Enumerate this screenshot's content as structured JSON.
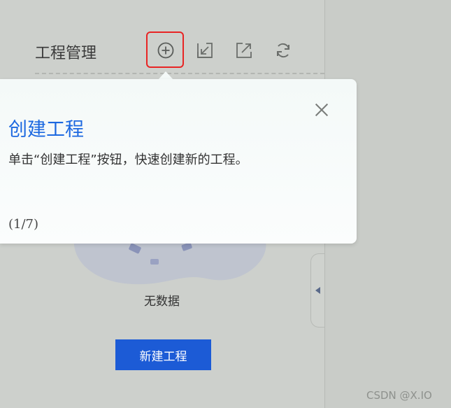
{
  "panel": {
    "title": "工程管理",
    "toolbar": [
      {
        "icon": "add-circle-icon",
        "label": "创建工程"
      },
      {
        "icon": "import-icon"
      },
      {
        "icon": "export-icon"
      },
      {
        "icon": "refresh-icon"
      }
    ],
    "empty_text": "无数据",
    "create_button_label": "新建工程"
  },
  "popover": {
    "title": "创建工程",
    "description": "单击“创建工程”按钮，快速创建新的工程。",
    "step": "(1/7)",
    "close_icon": "close-icon"
  },
  "colors": {
    "accent": "#1c68e0",
    "button": "#1c5bd6",
    "highlight": "#e82424"
  },
  "watermark": "CSDN @X.IO"
}
